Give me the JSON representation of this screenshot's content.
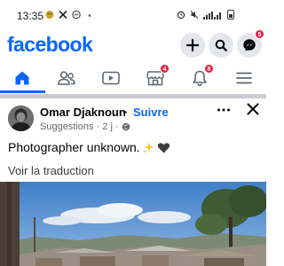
{
  "status_bar": {
    "time": "13:35",
    "left_icons": [
      "emoji-app-icon",
      "x-app-icon",
      "messenger-status-icon",
      "dot-icon"
    ],
    "right_icons": [
      "alarm-icon",
      "mute-icon",
      "signal-icon",
      "battery-icon"
    ]
  },
  "header": {
    "logo": "facebook",
    "messenger_badge": "5"
  },
  "tabs": [
    {
      "name": "home",
      "icon": "home-icon",
      "active": true
    },
    {
      "name": "friends",
      "icon": "friends-icon"
    },
    {
      "name": "video",
      "icon": "video-icon"
    },
    {
      "name": "marketplace",
      "icon": "marketplace-icon",
      "badge": "4"
    },
    {
      "name": "notifications",
      "icon": "bell-icon",
      "badge": "8"
    },
    {
      "name": "menu",
      "icon": "menu-icon"
    }
  ],
  "post": {
    "author": "Omar Djaknoun",
    "separator": "·",
    "follow_label": "Suivre",
    "meta_text": "Suggestions · 2 j ·",
    "caption": "Photographer unknown.",
    "caption_emojis": [
      "sparkles",
      "black-heart"
    ],
    "translate_label": "Voir la traduction"
  },
  "colors": {
    "brand": "#0866ff",
    "badge": "#e41e3f",
    "muted": "#65676b"
  }
}
